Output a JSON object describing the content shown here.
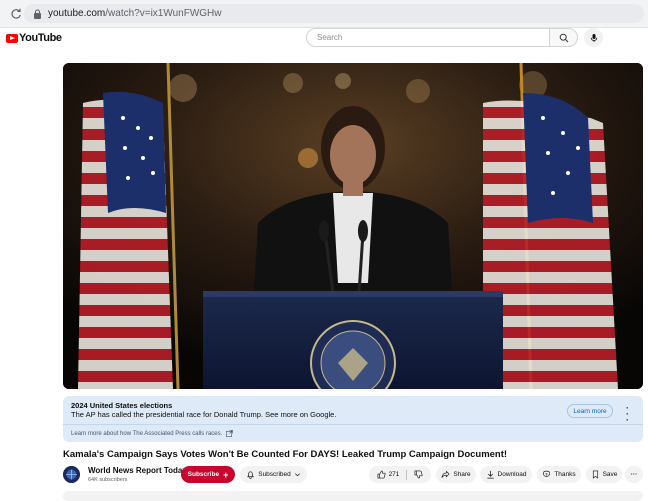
{
  "browser": {
    "url_host": "youtube.com",
    "url_path": "/watch?v=ix1WunFWGHw"
  },
  "header": {
    "logo_text": "YouTube",
    "search_placeholder": "Search"
  },
  "banner": {
    "title": "2024 United States elections",
    "text": "The AP has called the presidential race for Donald Trump. See more on Google.",
    "learn_more": "Learn more",
    "footer": "Learn more about how The Associated Press calls races."
  },
  "video": {
    "title": "Kamala's Campaign Says Votes Won't Be Counted For DAYS! Leaked Trump Campaign Document!",
    "channel": "World News Report Today",
    "subscribers": "64K subscribers",
    "subscribe_label": "Subscribe",
    "subscribed_label": "Subscribed",
    "likes": "271",
    "share_label": "Share",
    "download_label": "Download",
    "thanks_label": "Thanks",
    "save_label": "Save"
  },
  "colors": {
    "subscribe_red": "#c9062e",
    "banner_blue": "#deeaf7",
    "link_blue": "#065fd4",
    "youtube_red": "#ff0000"
  }
}
